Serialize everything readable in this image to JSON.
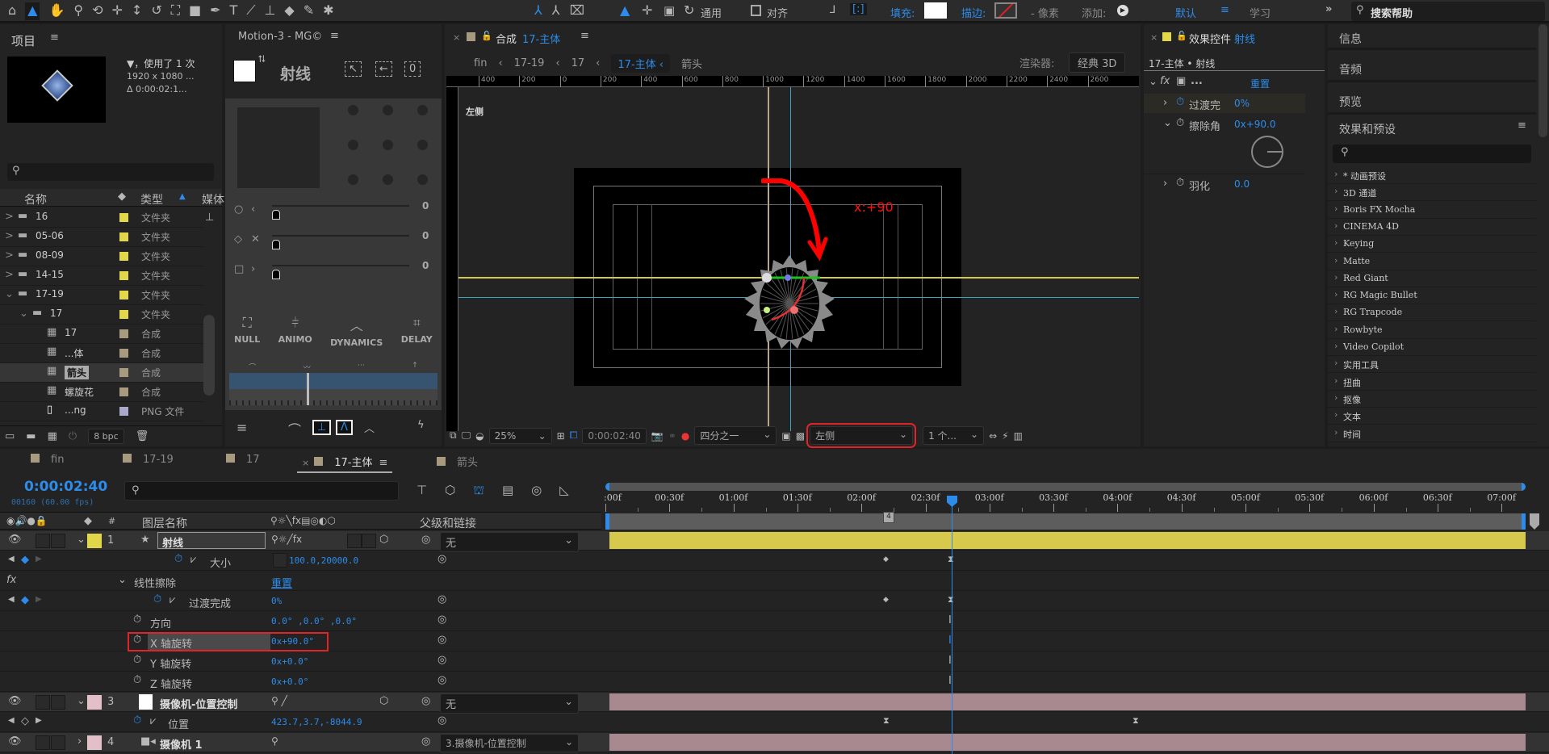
{
  "toolbar": {
    "tools": [
      "home-icon",
      "selection-icon",
      "hand-icon",
      "zoom-icon",
      "orbit-camera-icon",
      "pan-camera-icon",
      "dolly-camera-icon",
      "rotate-icon",
      "anchor-icon",
      "rectangle-icon",
      "pen-icon",
      "text-icon",
      "brush-icon",
      "clone-stamp-icon",
      "eraser-icon",
      "roto-brush-icon",
      "puppet-icon"
    ],
    "axis_tools": [
      "local-axis-icon",
      "world-axis-icon",
      "view-axis-icon"
    ],
    "general_label": "通用",
    "align_label": "对齐",
    "fill_label": "填充:",
    "stroke_label": "描边:",
    "pixels_label": "- 像素",
    "add_label": "添加:",
    "workspace_default": "默认",
    "workspace_learn": "学习",
    "search_help": "搜索帮助"
  },
  "project": {
    "title": "项目",
    "usage": "▼，使用了 1 次",
    "resolution": "1920 x 1080 ...",
    "duration": "Δ 0:00:02:1...",
    "columns": {
      "name": "名称",
      "type": "类型",
      "media": "媒体"
    },
    "items": [
      {
        "name": "16",
        "type": "文件夹",
        "kind": "folder",
        "indent": 0,
        "expand": ">",
        "color": "#e2d64a"
      },
      {
        "name": "05-06",
        "type": "文件夹",
        "kind": "folder",
        "indent": 0,
        "expand": ">",
        "color": "#e2d64a"
      },
      {
        "name": "08-09",
        "type": "文件夹",
        "kind": "folder",
        "indent": 0,
        "expand": ">",
        "color": "#e2d64a"
      },
      {
        "name": "14-15",
        "type": "文件夹",
        "kind": "folder",
        "indent": 0,
        "expand": ">",
        "color": "#e2d64a"
      },
      {
        "name": "17-19",
        "type": "文件夹",
        "kind": "folder",
        "indent": 0,
        "expand": "⌄",
        "color": "#e2d64a"
      },
      {
        "name": "17",
        "type": "文件夹",
        "kind": "folder",
        "indent": 1,
        "expand": "⌄",
        "color": "#e2d64a"
      },
      {
        "name": "17",
        "type": "合成",
        "kind": "comp",
        "indent": 2,
        "expand": "",
        "color": "#a89a7e"
      },
      {
        "name": "...体",
        "type": "合成",
        "kind": "comp",
        "indent": 2,
        "expand": "",
        "color": "#a89a7e"
      },
      {
        "name": "箭头",
        "type": "合成",
        "kind": "comp",
        "indent": 2,
        "expand": "",
        "color": "#a89a7e",
        "selected": true
      },
      {
        "name": "螺旋花",
        "type": "合成",
        "kind": "comp",
        "indent": 2,
        "expand": "",
        "color": "#a89a7e"
      },
      {
        "name": "...ng",
        "type": "PNG 文件",
        "kind": "png",
        "indent": 2,
        "expand": "",
        "color": "#a9a9c9"
      }
    ],
    "bpc": "8 bpc"
  },
  "motion": {
    "title": "Motion-3 - MG©",
    "layer_name": "射线",
    "slider_values": [
      "0",
      "0",
      "0"
    ],
    "tools": [
      "NULL",
      "ANIMO",
      "DYNAMICS",
      "DELAY"
    ]
  },
  "comp": {
    "tab_prefix": "合成",
    "tab_name": "17-主体",
    "breadcrumbs": [
      "fin",
      "17-19",
      "17",
      "17-主体",
      "箭头"
    ],
    "renderer_label": "渲染器:",
    "renderer_value": "经典 3D",
    "ruler_top": [
      "400",
      "200",
      "0",
      "200",
      "400",
      "600",
      "800",
      "1000",
      "1200",
      "1400",
      "1600",
      "1800",
      "2000",
      "2200",
      "2400",
      "2600"
    ],
    "view_label": "左侧",
    "annotation": "x:+90",
    "zoom": "25%",
    "timecode": "0:00:02:40",
    "resolution": "四分之一",
    "view_select": "左侧",
    "views_count": "1 个..."
  },
  "effect_controls": {
    "title_prefix": "效果控件",
    "layer": "射线",
    "subtitle": "17-主体 • 射线",
    "effect_name": "...",
    "reset": "重置",
    "params": [
      {
        "name": "过渡完",
        "value": "0%"
      },
      {
        "name": "擦除角",
        "value": "0x+90.0"
      },
      {
        "name": "羽化",
        "value": "0.0"
      }
    ],
    "wipe_angle_deg": 90
  },
  "right": {
    "info": "信息",
    "audio": "音频",
    "preview": "预览",
    "effects_title": "效果和预设",
    "effects": [
      "* 动画预设",
      "3D 通道",
      "Boris FX Mocha",
      "CINEMA 4D",
      "Keying",
      "Matte",
      "Red Giant",
      "RG Magic Bullet",
      "RG Trapcode",
      "Rowbyte",
      "Video Copilot",
      "实用工具",
      "扭曲",
      "抠像",
      "文本",
      "时间"
    ]
  },
  "timeline": {
    "tabs": [
      {
        "name": "fin",
        "active": false
      },
      {
        "name": "17-19",
        "active": false
      },
      {
        "name": "17",
        "active": false
      },
      {
        "name": "17-主体",
        "active": true
      },
      {
        "name": "箭头",
        "active": false
      }
    ],
    "current_time": "0:00:02:40",
    "frame_info": "00160 (60.00 fps)",
    "col_layer_name": "图层名称",
    "col_parent": "父级和链接",
    "ruler": [
      ":00f",
      "00:30f",
      "01:00f",
      "01:30f",
      "02:00f",
      "02:30f",
      "03:00f",
      "03:30f",
      "04:00f",
      "04:30f",
      "05:00f",
      "05:30f",
      "06:00f",
      "06:30f",
      "07:00f"
    ],
    "playhead_time": "02:40",
    "marker": "4",
    "layers": {
      "l1": {
        "num": "1",
        "name": "射线",
        "parent": "无",
        "color": "#e2d64a"
      },
      "size": {
        "name": "大小",
        "value": "100.0,20000.0"
      },
      "fx": {
        "name": "线性擦除",
        "reset": "重置"
      },
      "transition": {
        "name": "过渡完成",
        "value": "0%"
      },
      "direction": {
        "name": "方向",
        "value": "0.0° ,0.0° ,0.0°"
      },
      "xrot": {
        "name": "X 轴旋转",
        "value": "0x+90.0°"
      },
      "yrot": {
        "name": "Y 轴旋转",
        "value": "0x+0.0°"
      },
      "zrot": {
        "name": "Z 轴旋转",
        "value": "0x+0.0°"
      },
      "l3": {
        "num": "3",
        "name": "摄像机-位置控制",
        "parent": "无",
        "color": "#e3bfc8"
      },
      "position": {
        "name": "位置",
        "value": "423.7,3.7,-8044.9"
      },
      "l4": {
        "num": "4",
        "name": "摄像机 1",
        "parent": "3.摄像机-位置控制",
        "color": "#e3bfc8"
      }
    }
  },
  "colors": {
    "accent": "#2d8ceb",
    "highlight_box": "#e0242a",
    "yellow_bar": "#d7c94c",
    "pink_bar": "#a8898f",
    "work_area": "#19b428"
  }
}
